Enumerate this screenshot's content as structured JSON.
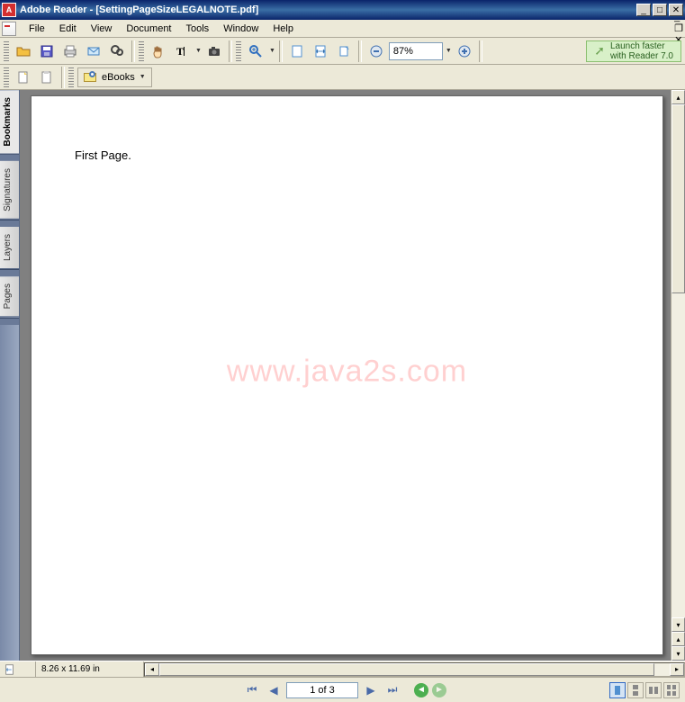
{
  "title": "Adobe Reader - [SettingPageSizeLEGALNOTE.pdf]",
  "menu": [
    "File",
    "Edit",
    "View",
    "Document",
    "Tools",
    "Window",
    "Help"
  ],
  "toolbar2": {
    "ebooks_label": "eBooks"
  },
  "zoom": {
    "value": "87%"
  },
  "promo": {
    "line1": "Launch faster",
    "line2": "with Reader 7.0"
  },
  "side_tabs": [
    "Bookmarks",
    "Signatures",
    "Layers",
    "Pages"
  ],
  "document": {
    "page_text": "First Page.",
    "watermark": "www.java2s.com"
  },
  "infobar": {
    "page_size": "8.26 x 11.69 in"
  },
  "nav": {
    "page_indicator": "1 of 3"
  }
}
